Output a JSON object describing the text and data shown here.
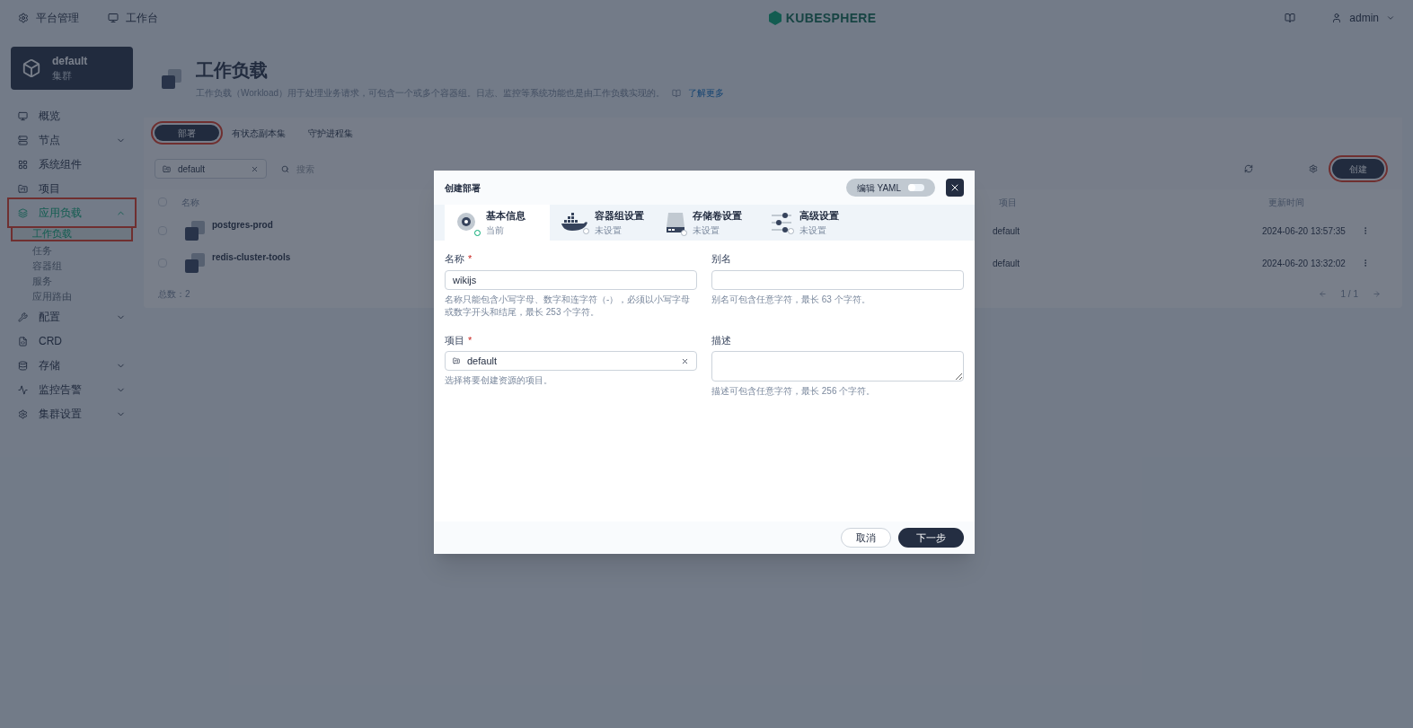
{
  "topbar": {
    "links": [
      "平台管理",
      "工作台"
    ],
    "logo": "KUBESPHERE",
    "user": "admin"
  },
  "cluster": {
    "name": "default",
    "type": "集群"
  },
  "sidebar": {
    "items": [
      {
        "label": "概览",
        "expandable": false,
        "expanded": false,
        "highlighted": false
      },
      {
        "label": "节点",
        "expandable": true,
        "expanded": false,
        "highlighted": false
      },
      {
        "label": "系统组件",
        "expandable": false,
        "expanded": false,
        "highlighted": false
      },
      {
        "label": "项目",
        "expandable": false,
        "expanded": false,
        "highlighted": false
      },
      {
        "label": "应用负载",
        "expandable": true,
        "expanded": true,
        "highlighted": true,
        "children": [
          {
            "label": "工作负载",
            "selected": true,
            "highlighted": true
          },
          {
            "label": "任务",
            "selected": false,
            "highlighted": false
          },
          {
            "label": "容器组",
            "selected": false,
            "highlighted": false
          },
          {
            "label": "服务",
            "selected": false,
            "highlighted": false
          },
          {
            "label": "应用路由",
            "selected": false,
            "highlighted": false
          }
        ]
      },
      {
        "label": "配置",
        "expandable": true,
        "expanded": false,
        "highlighted": false
      },
      {
        "label": "CRD",
        "expandable": false,
        "expanded": false,
        "highlighted": false
      },
      {
        "label": "存储",
        "expandable": true,
        "expanded": false,
        "highlighted": false
      },
      {
        "label": "监控告警",
        "expandable": true,
        "expanded": false,
        "highlighted": false
      },
      {
        "label": "集群设置",
        "expandable": true,
        "expanded": false,
        "highlighted": false
      }
    ]
  },
  "page": {
    "title": "工作负载",
    "description": "工作负载（Workload）用于处理业务请求，可包含一个或多个容器组。日志、监控等系统功能也是由工作负载实现的。",
    "link": "了解更多"
  },
  "tabs": [
    {
      "label": "部署",
      "selected": true,
      "highlighted": true
    },
    {
      "label": "有状态副本集",
      "selected": false,
      "highlighted": false
    },
    {
      "label": "守护进程集",
      "selected": false,
      "highlighted": false
    }
  ],
  "toolbar": {
    "project_filter": "default",
    "search_placeholder": "搜索",
    "create_button": {
      "label": "创建",
      "highlighted": true
    }
  },
  "table": {
    "header_checked": false,
    "columns": [
      "名称",
      "项目",
      "更新时间"
    ],
    "rows": [
      {
        "checked": false,
        "name": "postgres-prod",
        "project": "default",
        "updated": "2024-06-20 13:57:35"
      },
      {
        "checked": false,
        "name": "redis-cluster-tools",
        "project": "default",
        "updated": "2024-06-20 13:32:02"
      }
    ],
    "total": "总数：2",
    "pagination": "1 / 1"
  },
  "modal": {
    "title": "创建部署",
    "yaml_toggle": {
      "label": "编辑 YAML",
      "on": false
    },
    "steps": [
      {
        "title": "基本信息",
        "status": "当前",
        "selected": true
      },
      {
        "title": "容器组设置",
        "status": "未设置",
        "selected": false
      },
      {
        "title": "存储卷设置",
        "status": "未设置",
        "selected": false
      },
      {
        "title": "高级设置",
        "status": "未设置",
        "selected": false
      }
    ],
    "fields": [
      {
        "kind": "input",
        "label": "名称",
        "required_mark": "*",
        "value": "wikijs",
        "hint": "名称只能包含小写字母、数字和连字符（-），必须以小写字母或数字开头和结尾，最长 253 个字符。"
      },
      {
        "kind": "input",
        "label": "别名",
        "hint": "别名可包含任意字符，最长 63 个字符。"
      },
      {
        "kind": "select",
        "label": "项目",
        "required_mark": "*",
        "value": "default",
        "hint": "选择将要创建资源的项目。"
      },
      {
        "kind": "textarea",
        "label": "描述",
        "hint": "描述可包含任意字符，最长 256 个字符。"
      }
    ],
    "buttons": {
      "cancel": "取消",
      "next": "下一步"
    }
  }
}
